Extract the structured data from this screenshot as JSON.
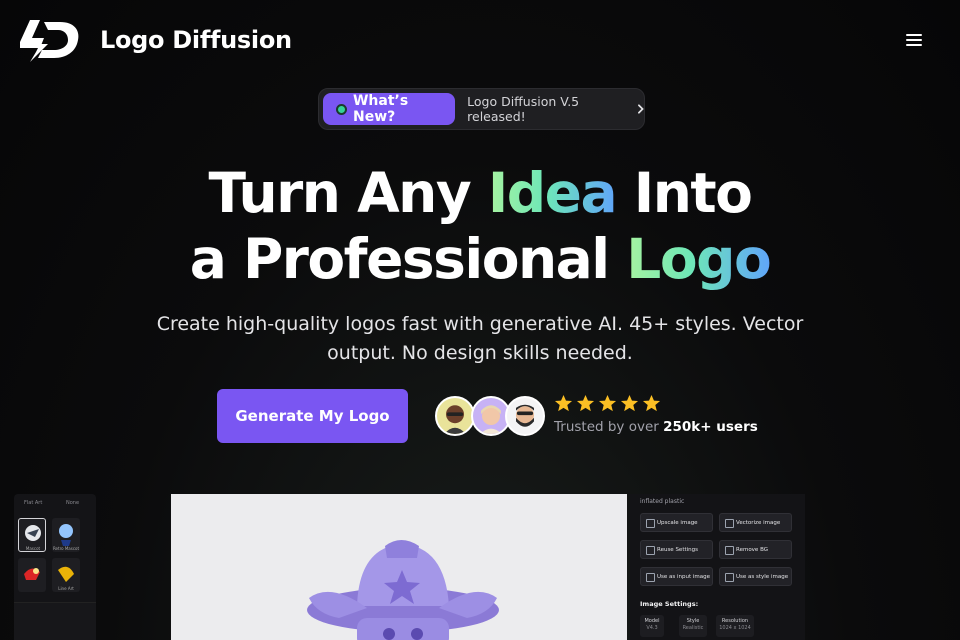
{
  "brand": {
    "name": "Logo Diffusion"
  },
  "announcement": {
    "pill_label": "What’s New?",
    "text": "Logo Diffusion V.5 released!"
  },
  "hero": {
    "line1_start": "Turn Any ",
    "line1_highlight": "Idea",
    "line1_end": " Into",
    "line2_start": "a Professional ",
    "line2_highlight": "Logo",
    "subtitle": "Create high-quality logos fast with generative AI. 45+ styles. Vector output. No design skills needed.",
    "cta_label": "Generate My Logo"
  },
  "social_proof": {
    "rating_stars": 5,
    "trusted_prefix": "Trusted by over ",
    "trusted_count": "250k+ users"
  },
  "app_preview": {
    "left_tabs": [
      "Flat Art",
      "None"
    ],
    "thumb_labels": [
      "Mascot",
      "Retro Mascot",
      "",
      "Line Art"
    ],
    "prompt_text": "inflated plastic",
    "actions": [
      "Upscale image",
      "Vectorize image",
      "Reuse Settings",
      "Remove BG",
      "Use as input image",
      "Use as style image"
    ],
    "settings_title": "Image Settings:",
    "settings": [
      {
        "label": "Model",
        "value": "V4.3"
      },
      {
        "label": "Style",
        "value": "Realistic"
      },
      {
        "label": "Resolution",
        "value": "1024 x 1024"
      }
    ]
  },
  "colors": {
    "accent": "#7a56f2",
    "background": "#0b0b0c",
    "star": "#fbbf24",
    "status_dot": "#34d399"
  }
}
